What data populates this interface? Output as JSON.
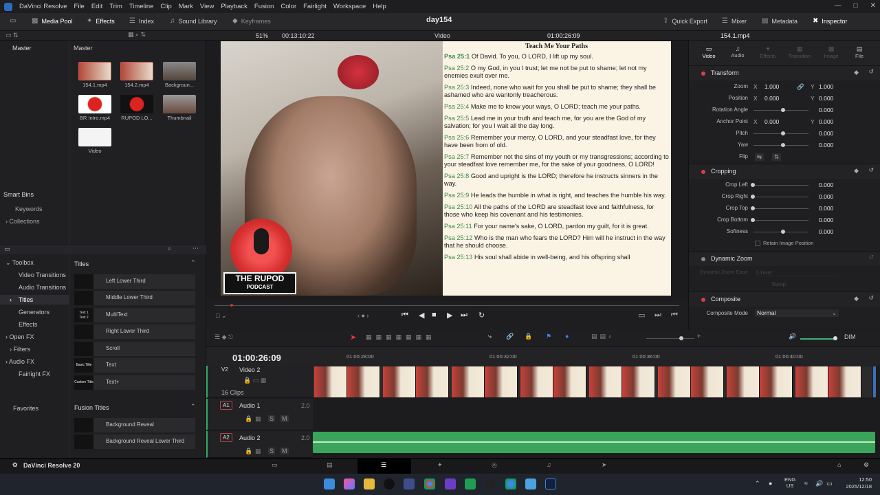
{
  "menubar": {
    "app": "DaVinci Resolve",
    "items": [
      "File",
      "Edit",
      "Trim",
      "Timeline",
      "Clip",
      "Mark",
      "View",
      "Playback",
      "Fusion",
      "Color",
      "Fairlight",
      "Workspace",
      "Help"
    ]
  },
  "toolbar": {
    "media_pool": "Media Pool",
    "effects": "Effects",
    "index": "Index",
    "sound_library": "Sound Library",
    "keyframes": "Keyframes",
    "project": "day154",
    "quick_export": "Quick Export",
    "mixer": "Mixer",
    "metadata": "Metadata",
    "inspector": "Inspector"
  },
  "viewer_bar": {
    "zoom": "51%",
    "duration": "00:13:10:22",
    "mode": "Video",
    "timecode": "01:00:26:09",
    "clip": "154.1.mp4"
  },
  "media_pool": {
    "root": "Master",
    "breadcrumb": "Master",
    "clips": [
      {
        "name": "154.1.mp4"
      },
      {
        "name": "154.2.mp4"
      },
      {
        "name": "Backgroun..."
      },
      {
        "name": "BR Intro.mp4"
      },
      {
        "name": "RUPOD LO..."
      },
      {
        "name": "Thumbnail"
      },
      {
        "name": "Video"
      }
    ],
    "smart_bins": "Smart Bins",
    "keywords": "Keywords",
    "collections": "Collections"
  },
  "effects": {
    "tree": [
      "Toolbox",
      "Video Transitions",
      "Audio Transitions",
      "Titles",
      "Generators",
      "Effects",
      "Open FX",
      "Filters",
      "Audio FX",
      "Fairlight FX",
      "Favorites"
    ],
    "titles_header": "Titles",
    "titles": [
      "Left Lower Third",
      "Middle Lower Third",
      "MultiText",
      "Right Lower Third",
      "Scroll",
      "Text",
      "Text+"
    ],
    "thumb_labels": [
      "",
      "",
      "Text 1\nText 2",
      "",
      "",
      "Basic Title",
      "Custom Title"
    ],
    "fusion_header": "Fusion Titles",
    "fusion_titles": [
      "Background Reveal",
      "Background Reveal Lower Third"
    ]
  },
  "overlay": {
    "logo_line1": "THE RUPOD",
    "logo_line2": "PODCAST"
  },
  "bible": {
    "title": "Teach Me Your Paths",
    "verses": [
      {
        "ref": "Psa 25:1",
        "text": " Of David. To you, O LORD, I lift up my soul."
      },
      {
        "ref": "Psa 25:2",
        "text": " O my God, in you I trust; let me not be put to shame; let not my enemies exult over me."
      },
      {
        "ref": "Psa 25:3",
        "text": " Indeed, none who wait for you shall be put to shame; they shall be ashamed who are wantonly treacherous."
      },
      {
        "ref": "Psa 25:4",
        "text": " Make me to know your ways, O LORD; teach me your paths."
      },
      {
        "ref": "Psa 25:5",
        "text": " Lead me in your truth and teach me, for you are the God of my salvation; for you I wait all the day long."
      },
      {
        "ref": "Psa 25:6",
        "text": " Remember your mercy, O LORD, and your steadfast love, for they have been from of old."
      },
      {
        "ref": "Psa 25:7",
        "text": " Remember not the sins of my youth or my transgressions; according to your steadfast love remember me, for the sake of your goodness, O LORD!"
      },
      {
        "ref": "Psa 25:8",
        "text": " Good and upright is the LORD; therefore he instructs sinners in the way."
      },
      {
        "ref": "Psa 25:9",
        "text": " He leads the humble in what is right, and teaches the humble his way."
      },
      {
        "ref": "Psa 25:10",
        "text": " All the paths of the LORD are steadfast love and faithfulness, for those who keep his covenant and his testimonies."
      },
      {
        "ref": "Psa 25:11",
        "text": " For your name's sake, O LORD, pardon my guilt, for it is great."
      },
      {
        "ref": "Psa 25:12",
        "text": " Who is the man who fears the LORD? Him will he instruct in the way that he should choose."
      },
      {
        "ref": "Psa 25:13",
        "text": " His soul shall abide in well-being, and his offspring shall"
      }
    ]
  },
  "inspector": {
    "tabs": [
      "Video",
      "Audio",
      "Effects",
      "Transition",
      "Image",
      "File"
    ],
    "transform": "Transform",
    "zoom_label": "Zoom",
    "zoom_x": "1.000",
    "zoom_y": "1.000",
    "position_label": "Position",
    "pos_x": "0.000",
    "pos_y": "0.000",
    "rotation_label": "Rotation Angle",
    "rotation": "0.000",
    "anchor_label": "Anchor Point",
    "anchor_x": "0.000",
    "anchor_y": "0.000",
    "pitch_label": "Pitch",
    "pitch": "0.000",
    "yaw_label": "Yaw",
    "yaw": "0.000",
    "flip_label": "Flip",
    "cropping": "Cropping",
    "crop_left_label": "Crop Left",
    "crop_left": "0.000",
    "crop_right_label": "Crop Right",
    "crop_right": "0.000",
    "crop_top_label": "Crop Top",
    "crop_top": "0.000",
    "crop_bottom_label": "Crop Bottom",
    "crop_bottom": "0.000",
    "softness_label": "Softness",
    "softness": "0.000",
    "retain": "Retain Image Position",
    "dynamic_zoom": "Dynamic Zoom",
    "dz_ease_label": "Dynamic Zoom Ease",
    "dz_ease": "Linear",
    "swap": "Swap",
    "composite": "Composite",
    "composite_mode_label": "Composite Mode",
    "composite_mode": "Normal",
    "x": "X",
    "y": "Y"
  },
  "timeline": {
    "timecode": "01:00:26:09",
    "ruler": [
      "01:00:28:00",
      "01:00:32:00",
      "01:00:36:00",
      "01:00:40:00"
    ],
    "v2_badge": "V2",
    "v2_name": "Video 2",
    "clips_count": "16 Clips",
    "a1_badge": "A1",
    "a1_name": "Audio 1",
    "a1_ch": "2.0",
    "a2_badge": "A2",
    "a2_name": "Audio 2",
    "a2_ch": "2.0",
    "dim": "DIM",
    "s": "S",
    "m": "M"
  },
  "pagebar": {
    "app": "DaVinci Resolve 20"
  },
  "taskbar": {
    "lang1": "ENG",
    "lang2": "US",
    "time": "12:50",
    "date": "2025/12/18"
  }
}
